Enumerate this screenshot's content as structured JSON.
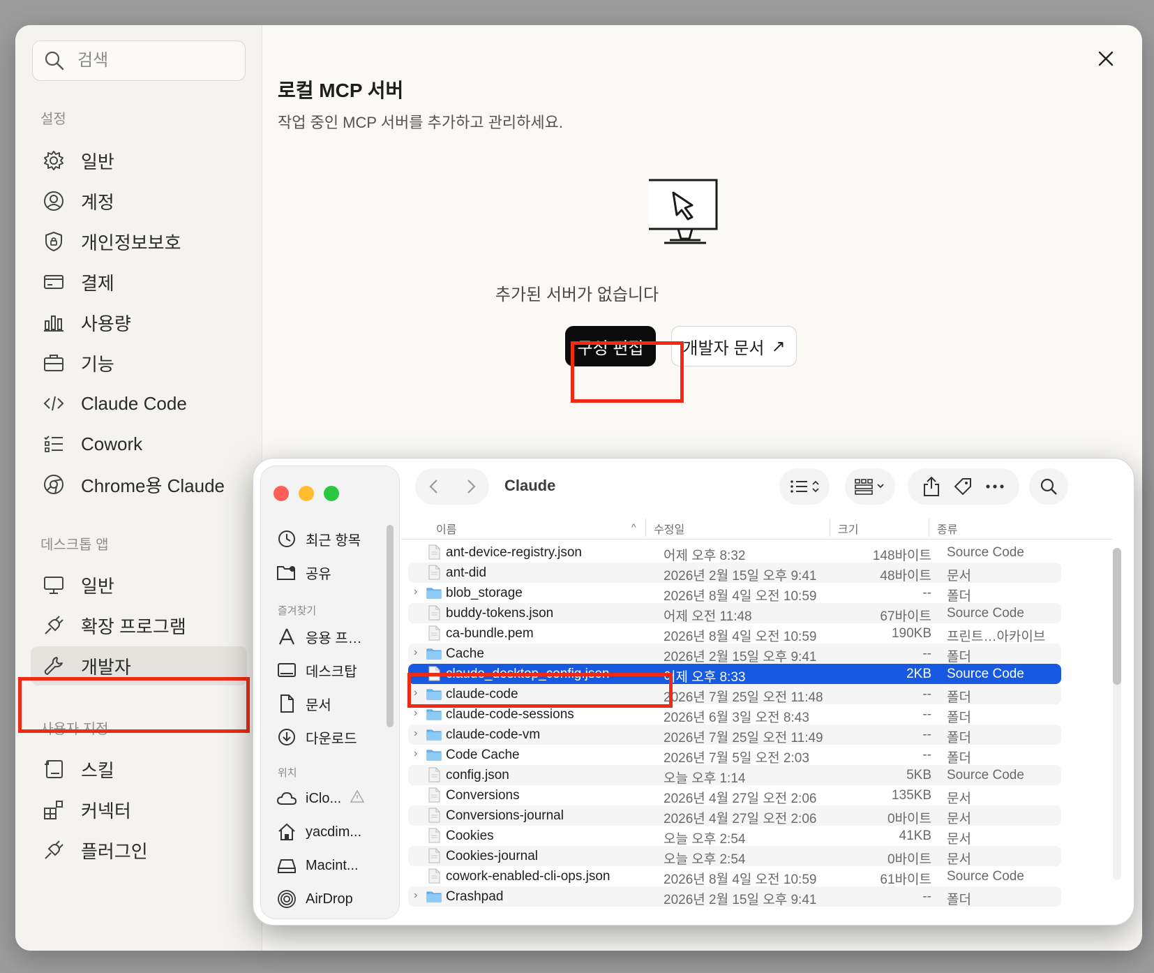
{
  "search": {
    "placeholder": "검색"
  },
  "sections": {
    "settings": "설정",
    "desktop": "데스크톱 앱",
    "custom": "사용자 지정"
  },
  "nav_settings": [
    {
      "label": "일반",
      "icon": "gear-icon"
    },
    {
      "label": "계정",
      "icon": "account-icon"
    },
    {
      "label": "개인정보보호",
      "icon": "shield-icon"
    },
    {
      "label": "결제",
      "icon": "card-icon"
    },
    {
      "label": "사용량",
      "icon": "bar-chart-icon"
    },
    {
      "label": "기능",
      "icon": "briefcase-icon"
    },
    {
      "label": "Claude Code",
      "icon": "code-icon"
    },
    {
      "label": "Cowork",
      "icon": "checklist-icon"
    },
    {
      "label": "Chrome용 Claude",
      "icon": "chrome-icon"
    }
  ],
  "nav_desktop": [
    {
      "label": "일반",
      "icon": "monitor-icon"
    },
    {
      "label": "확장 프로그램",
      "icon": "plug-icon"
    },
    {
      "label": "개발자",
      "icon": "wrench-icon"
    }
  ],
  "nav_custom": [
    {
      "label": "스킬",
      "icon": "skill-icon"
    },
    {
      "label": "커넥터",
      "icon": "connector-icon"
    },
    {
      "label": "플러그인",
      "icon": "plugin-icon"
    }
  ],
  "main": {
    "title": "로컬 MCP 서버",
    "subtitle": "작업 중인 MCP 서버를 추가하고 관리하세요.",
    "empty": "추가된 서버가 없습니다",
    "edit_config": "구성 편집",
    "dev_docs": "개발자 문서",
    "dev_docs_arrow": "↗"
  },
  "finder": {
    "title": "Claude",
    "sidebar": {
      "items_top": [
        {
          "label": "최근 항목",
          "icon": "clock-icon"
        },
        {
          "label": "공유",
          "icon": "shared-folder-icon"
        }
      ],
      "favorites_label": "즐겨찾기",
      "favorites": [
        {
          "label": "응용 프…",
          "icon": "apps-icon"
        },
        {
          "label": "데스크탑",
          "icon": "desktop-icon"
        },
        {
          "label": "문서",
          "icon": "document-icon"
        },
        {
          "label": "다운로드",
          "icon": "download-icon"
        }
      ],
      "locations_label": "위치",
      "locations": [
        {
          "label": "iClo...",
          "icon": "icloud-icon"
        },
        {
          "label": "yacdim...",
          "icon": "home-icon"
        },
        {
          "label": "Macint...",
          "icon": "disk-icon"
        },
        {
          "label": "AirDrop",
          "icon": "airdrop-icon"
        }
      ]
    },
    "columns": {
      "name": "이름",
      "modified": "수정일",
      "size": "크기",
      "kind": "종류"
    },
    "rows": [
      {
        "name": "ant-device-registry.json",
        "date": "어제 오후 8:32",
        "size": "148바이트",
        "kind": "Source Code",
        "folder": false
      },
      {
        "name": "ant-did",
        "date": "2026년 2월 15일 오후 9:41",
        "size": "48바이트",
        "kind": "문서",
        "folder": false
      },
      {
        "name": "blob_storage",
        "date": "2026년 8월 4일 오전 10:59",
        "size": "--",
        "kind": "폴더",
        "folder": true
      },
      {
        "name": "buddy-tokens.json",
        "date": "어제 오전 11:48",
        "size": "67바이트",
        "kind": "Source Code",
        "folder": false
      },
      {
        "name": "ca-bundle.pem",
        "date": "2026년 8월 4일 오전 10:59",
        "size": "190KB",
        "kind": "프린트…아카이브",
        "folder": false
      },
      {
        "name": "Cache",
        "date": "2026년 2월 15일 오후 9:41",
        "size": "--",
        "kind": "폴더",
        "folder": true
      },
      {
        "name": "claude_desktop_config.json",
        "date": "어제 오후 8:33",
        "size": "2KB",
        "kind": "Source Code",
        "folder": false,
        "selected": true
      },
      {
        "name": "claude-code",
        "date": "2026년 7월 25일 오전 11:48",
        "size": "--",
        "kind": "폴더",
        "folder": true
      },
      {
        "name": "claude-code-sessions",
        "date": "2026년 6월 3일 오전 8:43",
        "size": "--",
        "kind": "폴더",
        "folder": true
      },
      {
        "name": "claude-code-vm",
        "date": "2026년 7월 25일 오전 11:49",
        "size": "--",
        "kind": "폴더",
        "folder": true
      },
      {
        "name": "Code Cache",
        "date": "2026년 7월 5일 오전 2:03",
        "size": "--",
        "kind": "폴더",
        "folder": true
      },
      {
        "name": "config.json",
        "date": "오늘 오후 1:14",
        "size": "5KB",
        "kind": "Source Code",
        "folder": false
      },
      {
        "name": "Conversions",
        "date": "2026년 4월 27일 오전 2:06",
        "size": "135KB",
        "kind": "문서",
        "folder": false
      },
      {
        "name": "Conversions-journal",
        "date": "2026년 4월 27일 오전 2:06",
        "size": "0바이트",
        "kind": "문서",
        "folder": false
      },
      {
        "name": "Cookies",
        "date": "오늘 오후 2:54",
        "size": "41KB",
        "kind": "문서",
        "folder": false
      },
      {
        "name": "Cookies-journal",
        "date": "오늘 오후 2:54",
        "size": "0바이트",
        "kind": "문서",
        "folder": false
      },
      {
        "name": "cowork-enabled-cli-ops.json",
        "date": "2026년 8월 4일 오전 10:59",
        "size": "61바이트",
        "kind": "Source Code",
        "folder": false
      },
      {
        "name": "Crashpad",
        "date": "2026년 2월 15일 오후 9:41",
        "size": "--",
        "kind": "폴더",
        "folder": true
      }
    ]
  }
}
